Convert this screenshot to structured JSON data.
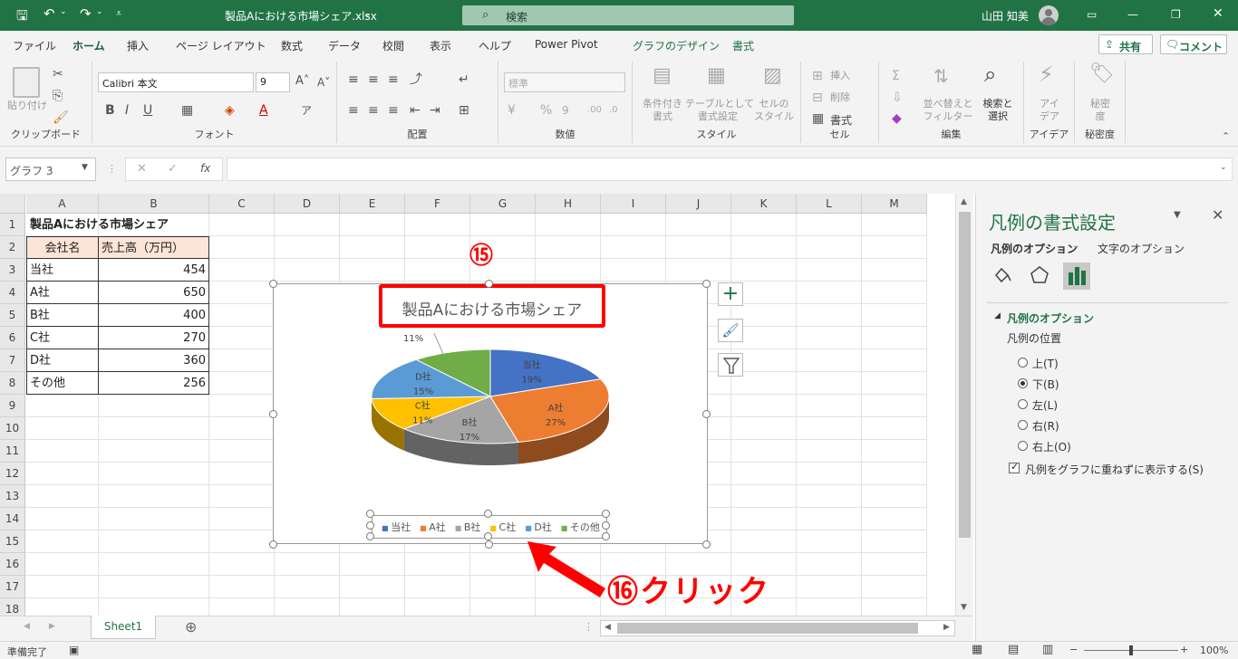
{
  "window": {
    "filename": "製品Aにおける市場シェア.xlsx",
    "search_label": "検索",
    "user": "山田 知美",
    "accent": "#217346"
  },
  "tabs": [
    "ファイル",
    "ホーム",
    "挿入",
    "ページ レイアウト",
    "数式",
    "データ",
    "校閲",
    "表示",
    "ヘルプ",
    "Power Pivot",
    "グラフのデザイン",
    "書式"
  ],
  "share_label": "共有",
  "comment_label": "コメント",
  "ribbon": {
    "clipboard": {
      "paste": "貼り付け",
      "group": "クリップボード"
    },
    "font": {
      "name": "Calibri 本文",
      "size": "9",
      "group": "フォント"
    },
    "align": {
      "group": "配置"
    },
    "number": {
      "format": "標準",
      "group": "数値"
    },
    "style": {
      "cond": "条件付き\n書式",
      "table": "テーブルとして\n書式設定",
      "cell": "セルの\nスタイル",
      "group": "スタイル"
    },
    "cells": {
      "insert": "挿入",
      "delete": "削除",
      "format": "書式",
      "group": "セル"
    },
    "edit": {
      "sort": "並べ替えと\nフィルター",
      "find": "検索と\n選択",
      "group": "編集"
    },
    "idea": {
      "label": "アイ\nデア",
      "group": "アイデア"
    },
    "secret": {
      "label": "秘密\n度",
      "group": "秘密度"
    }
  },
  "formula_bar": {
    "name_box": "グラフ 3",
    "fx": "fx"
  },
  "columns": [
    "A",
    "B",
    "C",
    "D",
    "E",
    "F",
    "G",
    "H",
    "I",
    "J",
    "K",
    "L",
    "M"
  ],
  "rows": [
    "1",
    "2",
    "3",
    "4",
    "5",
    "6",
    "7",
    "8",
    "9",
    "10",
    "11",
    "12",
    "13",
    "14",
    "15",
    "16",
    "17",
    "18"
  ],
  "sheet": {
    "title": "製品Aにおける市場シェア",
    "header_company": "会社名",
    "header_sales": "売上高（万円）",
    "data": [
      {
        "company": "当社",
        "sales": "454"
      },
      {
        "company": "A社",
        "sales": "650"
      },
      {
        "company": "B社",
        "sales": "400"
      },
      {
        "company": "C社",
        "sales": "270"
      },
      {
        "company": "D社",
        "sales": "360"
      },
      {
        "company": "その他",
        "sales": "256"
      }
    ]
  },
  "chart_data": {
    "type": "pie",
    "title": "製品Aにおける市場シェア",
    "categories": [
      "当社",
      "A社",
      "B社",
      "C社",
      "D社",
      "その他"
    ],
    "values": [
      454,
      650,
      400,
      270,
      360,
      256
    ],
    "percent_labels": [
      "19%",
      "27%",
      "17%",
      "11%",
      "15%",
      "11%"
    ],
    "colors": [
      "#4472c4",
      "#ed7d31",
      "#a5a5a5",
      "#ffc000",
      "#5b9bd5",
      "#70ad47"
    ],
    "legend_position": "bottom",
    "three_d": true
  },
  "annotations": {
    "step15": "⑮",
    "step16": "⑯クリック",
    "highlight_color": "#ff0000"
  },
  "pane": {
    "title": "凡例の書式設定",
    "tab_legend": "凡例のオプション",
    "tab_text": "文字のオプション",
    "section": "凡例のオプション",
    "position_label": "凡例の位置",
    "options": [
      "上(T)",
      "下(B)",
      "左(L)",
      "右(R)",
      "右上(O)"
    ],
    "selected": "下(B)",
    "checkbox": "凡例をグラフに重ねずに表示する(S)"
  },
  "sheet_tab": "Sheet1",
  "status": {
    "ready": "準備完了",
    "zoom": "100%"
  }
}
